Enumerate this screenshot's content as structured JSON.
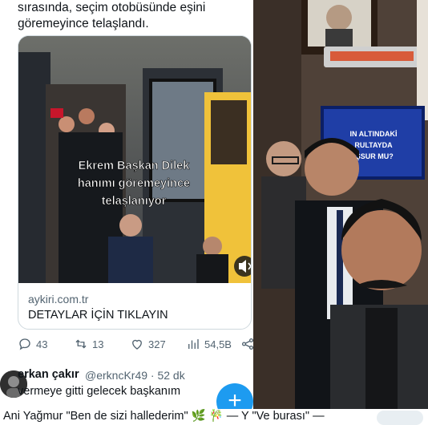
{
  "tweet": {
    "text_line1": "sırasında, seçim otobüsünde eşini",
    "text_line2": "göremeyince telaşlandı."
  },
  "card": {
    "video_caption_line1": "Ekrem Başkan Dilek",
    "video_caption_line2": "hanımı göremeyince",
    "video_caption_line3": "telaşlanıyor",
    "domain": "aykiri.com.tr",
    "title": "DETAYLAR İÇİN TIKLAYIN"
  },
  "actions": {
    "replies": "43",
    "retweets": "13",
    "likes": "327",
    "views": "54,5B"
  },
  "reply": {
    "name": "erkan çakır",
    "handle": "@erkncKr49 · 52 dk",
    "text": "vermeye gitti gelecek başkanım"
  },
  "photo": {
    "tv_text_line1": "IN ALTINDAKİ",
    "tv_text_line2": "RULTAYDA",
    "tv_text_line3": "IŞSUR MU?"
  },
  "bottom": {
    "text": "Ani Yağmur \"Ben de sizi hallederim\" 🌿 🎋 — Y \"Ve burası\" —"
  },
  "colors": {
    "accent": "#1d9bf0",
    "text": "#0f1419",
    "muted": "#536471"
  }
}
